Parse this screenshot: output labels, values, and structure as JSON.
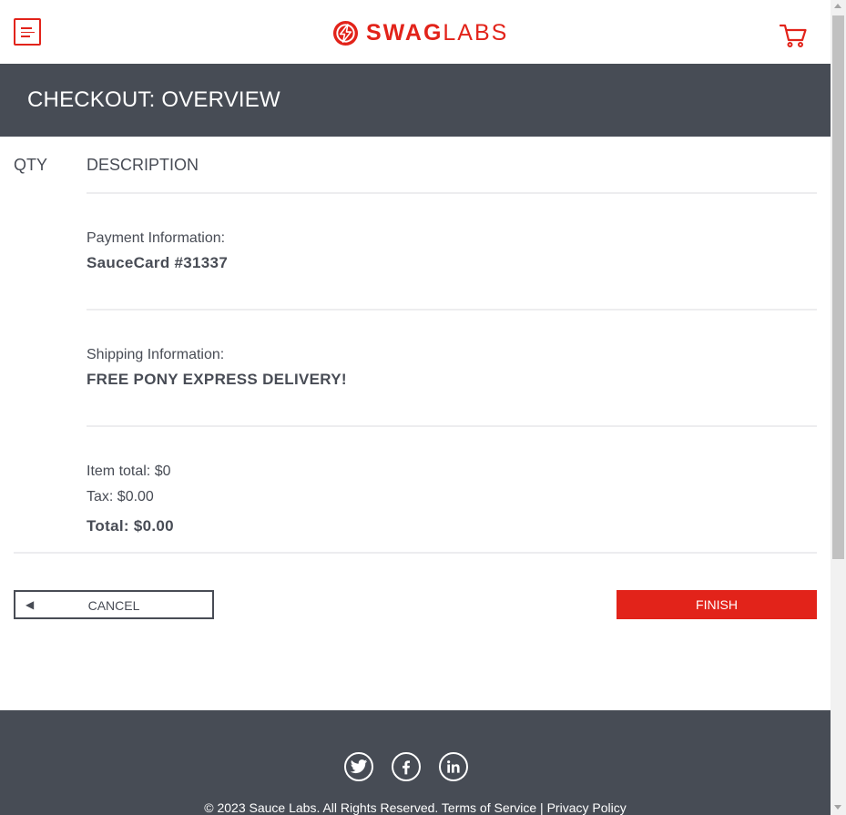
{
  "header": {
    "menu_icon": "hamburger-menu-icon",
    "brand": {
      "bold": "SWAG",
      "light": "LABS",
      "logo_icon": "sauce-bolt-icon"
    },
    "cart_icon": "shopping-cart-icon"
  },
  "page_title": "CHECKOUT: OVERVIEW",
  "list_header": {
    "qty": "QTY",
    "description": "DESCRIPTION"
  },
  "payment": {
    "label": "Payment Information:",
    "value": "SauceCard #31337"
  },
  "shipping": {
    "label": "Shipping Information:",
    "value": "FREE PONY EXPRESS DELIVERY!"
  },
  "summary": {
    "item_total": "Item total: $0",
    "tax": "Tax: $0.00",
    "total": "Total: $0.00"
  },
  "buttons": {
    "cancel_icon": "back-arrow-icon",
    "cancel_arrow": "◀",
    "cancel": "CANCEL",
    "finish": "FINISH"
  },
  "footer": {
    "social": [
      "twitter-icon",
      "facebook-icon",
      "linkedin-icon"
    ],
    "copyright": "© 2023 Sauce Labs. All Rights Reserved. Terms of Service | Privacy Policy"
  },
  "colors": {
    "accent": "#e2231a",
    "dark": "#474c55",
    "text": "#484c55",
    "divider": "#ededef"
  }
}
